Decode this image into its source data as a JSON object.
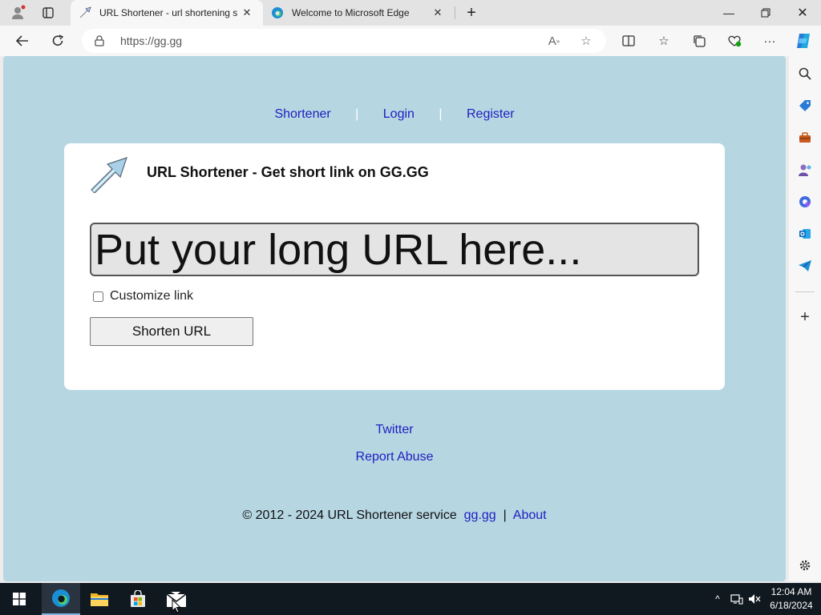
{
  "browser": {
    "tabs": [
      {
        "title": "URL Shortener - url shortening se",
        "active": true
      },
      {
        "title": "Welcome to Microsoft Edge",
        "active": false
      }
    ],
    "address": "https://gg.gg"
  },
  "page": {
    "nav": {
      "shortener": "Shortener",
      "login": "Login",
      "register": "Register",
      "separator": "|"
    },
    "card_title": "URL Shortener - Get short link on GG.GG",
    "input_placeholder": "Put your long URL here...",
    "customize_label": "Customize link",
    "shorten_button": "Shorten URL",
    "footer": {
      "twitter": "Twitter",
      "report_abuse": "Report Abuse",
      "copyright": "© 2012 - 2024 URL Shortener service",
      "site_link": "gg.gg",
      "separator": "|",
      "about": "About"
    }
  },
  "taskbar": {
    "time": "12:04 AM",
    "date": "6/18/2024"
  },
  "colors": {
    "page_bg": "#b6d6e2",
    "link": "#2020c0",
    "taskbar": "#101820"
  }
}
